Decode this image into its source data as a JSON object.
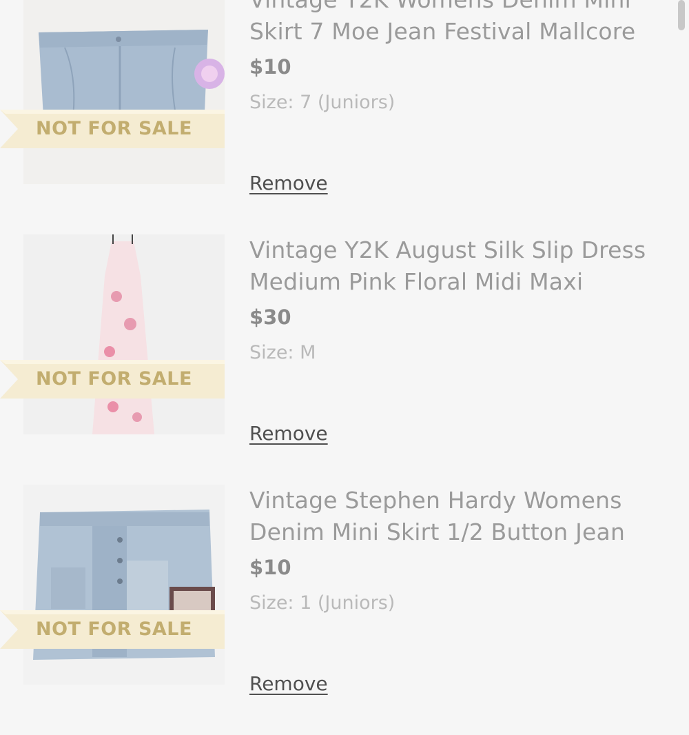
{
  "items": [
    {
      "title": "Vintage Y2K Womens Denim Mini Skirt 7 Moe Jean Festival Mallcore",
      "price": "$10",
      "size": "Size: 7 (Juniors)",
      "badge": "NOT FOR SALE",
      "remove_label": "Remove",
      "image_icon": "denim-skirt-photo"
    },
    {
      "title": "Vintage Y2K August Silk Slip Dress Medium Pink Floral Midi Maxi",
      "price": "$30",
      "size": "Size: M",
      "badge": "NOT FOR SALE",
      "remove_label": "Remove",
      "image_icon": "floral-dress-photo"
    },
    {
      "title": "Vintage Stephen Hardy Womens Denim Mini Skirt 1/2 Button Jean",
      "price": "$10",
      "size": "Size: 1 (Juniors)",
      "badge": "NOT FOR SALE",
      "remove_label": "Remove",
      "image_icon": "patchwork-denim-skirt-photo"
    }
  ],
  "colors": {
    "background": "#f6f6f6",
    "badge_gold": "#c2ad6f",
    "ribbon_fill": "#f5ecd2",
    "title": "#9a9a9a",
    "price": "#8a8a8a",
    "size": "#b9b9b9",
    "remove_link": "#4f4f4f"
  }
}
